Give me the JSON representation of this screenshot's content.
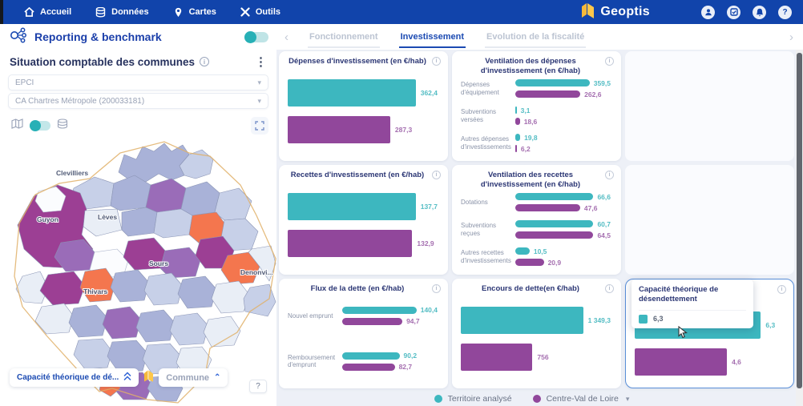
{
  "nav": {
    "brand": "Geoptis",
    "items": [
      {
        "label": "Accueil"
      },
      {
        "label": "Données"
      },
      {
        "label": "Cartes"
      },
      {
        "label": "Outils"
      }
    ]
  },
  "header": {
    "title": "Reporting & benchmark"
  },
  "tabs": [
    {
      "label": "Fonctionnement",
      "active": false
    },
    {
      "label": "Investissement",
      "active": true
    },
    {
      "label": "Evolution de la fiscalité",
      "active": false
    }
  ],
  "sidebar": {
    "title": "Situation comptable des communes",
    "filter_label": "EPCI",
    "filter_value": "CA Chartres Métropole (200033181)",
    "map_labels": [
      "Clevilliers",
      "Lèves",
      "Guyon",
      "Sours",
      "Thivars",
      "Denonvi..."
    ],
    "overlay_indicator": "Capacité théorique de dé...",
    "overlay_level": "Commune",
    "help_label": "?"
  },
  "tooltip": {
    "title": "Capacité théorique de désendettement",
    "value": "6,3"
  },
  "legend": {
    "items": [
      {
        "label": "Territoire analysé",
        "color": "#3db7bf"
      },
      {
        "label": "Centre-Val de Loire",
        "color": "#91479b"
      }
    ]
  },
  "colors": {
    "teal": "#3db7bf",
    "purple": "#91479b",
    "accent": "#1144ab",
    "highlight_border": "#5a8fd8",
    "map_orange": "#f4764e"
  },
  "chart_data": {
    "type": "bar",
    "unit": "€/hab",
    "orientation": "horizontal",
    "series_names": [
      "Territoire analysé",
      "Centre-Val de Loire"
    ],
    "cards": [
      {
        "title": "Dépenses d'investissement (en €/hab)",
        "type": "simple",
        "max": 420,
        "values": [
          362.4,
          287.3
        ],
        "labels": [
          "362,4",
          "287,3"
        ]
      },
      {
        "title": "Ventilation des dépenses d'investissement (en €/hab)",
        "type": "grouped",
        "max": 385,
        "rows": [
          {
            "category": "Dépenses d'équipement",
            "values": [
              359.5,
              262.6
            ],
            "labels": [
              "359,5",
              "262,6"
            ]
          },
          {
            "category": "Subventions versées",
            "values": [
              3.1,
              18.6
            ],
            "labels": [
              "3,1",
              "18,6"
            ]
          },
          {
            "category": "Autres dépenses d'investissements",
            "values": [
              19.8,
              6.2
            ],
            "labels": [
              "19,8",
              "6,2"
            ]
          }
        ]
      },
      {
        "title": "Recettes d'investissement (en €/hab)",
        "type": "simple",
        "max": 160,
        "values": [
          137.7,
          132.9
        ],
        "labels": [
          "137,7",
          "132,9"
        ]
      },
      {
        "title": "Ventilation des recettes d'investissement (en €/hab)",
        "type": "grouped",
        "max": 70,
        "rows": [
          {
            "category": "Dotations",
            "values": [
              66.6,
              47.6
            ],
            "labels": [
              "66,6",
              "47,6"
            ]
          },
          {
            "category": "Subventions reçues",
            "values": [
              60.7,
              64.5
            ],
            "labels": [
              "60,7",
              "64,5"
            ]
          },
          {
            "category": "Autres recettes d'investissements",
            "values": [
              10.5,
              20.9
            ],
            "labels": [
              "10,5",
              "20,9"
            ]
          }
        ]
      },
      {
        "title": "Flux de la dette (en €/hab)",
        "type": "grouped",
        "max": 150,
        "rows": [
          {
            "category": "Nouvel emprunt",
            "values": [
              140.4,
              94.7
            ],
            "labels": [
              "140,4",
              "94,7"
            ]
          },
          {
            "category": "Remboursement d'emprunt",
            "values": [
              90.2,
              82.7
            ],
            "labels": [
              "90,2",
              "82,7"
            ]
          }
        ]
      },
      {
        "title": "Encours de dette(en €/hab)",
        "type": "simple",
        "max": 1580,
        "values": [
          1349.3,
          756
        ],
        "labels": [
          "1 349,3",
          "756"
        ]
      },
      {
        "title": "Capacité théorique de désendettement",
        "type": "simple",
        "max": 7.4,
        "values": [
          6.3,
          4.6
        ],
        "labels": [
          "6,3",
          "4,6"
        ],
        "highlighted": true
      }
    ]
  }
}
